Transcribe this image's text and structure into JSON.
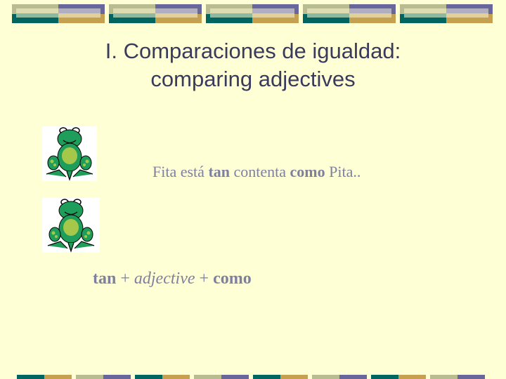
{
  "slide": {
    "title_line1": "I. Comparaciones de igualdad:",
    "title_line2": "comparing adjectives",
    "example": {
      "part1": "Fita está ",
      "tan": "tan",
      "part2": " contenta ",
      "como": "como",
      "part3": " Pita.."
    },
    "formula": {
      "tan": "tan",
      "plus1": " + ",
      "adjective": "adjective",
      "plus2": " + ",
      "como": "como"
    }
  },
  "images": [
    {
      "icon": "frog-icon"
    },
    {
      "icon": "frog-icon"
    }
  ],
  "colors": {
    "background": "#ffffd6",
    "title_text": "#3a3a5c",
    "body_text": "#7f7fa0",
    "teal": "#00645f",
    "gold": "#c4a050",
    "khaki": "#b9bb91",
    "purple": "#68679b"
  }
}
